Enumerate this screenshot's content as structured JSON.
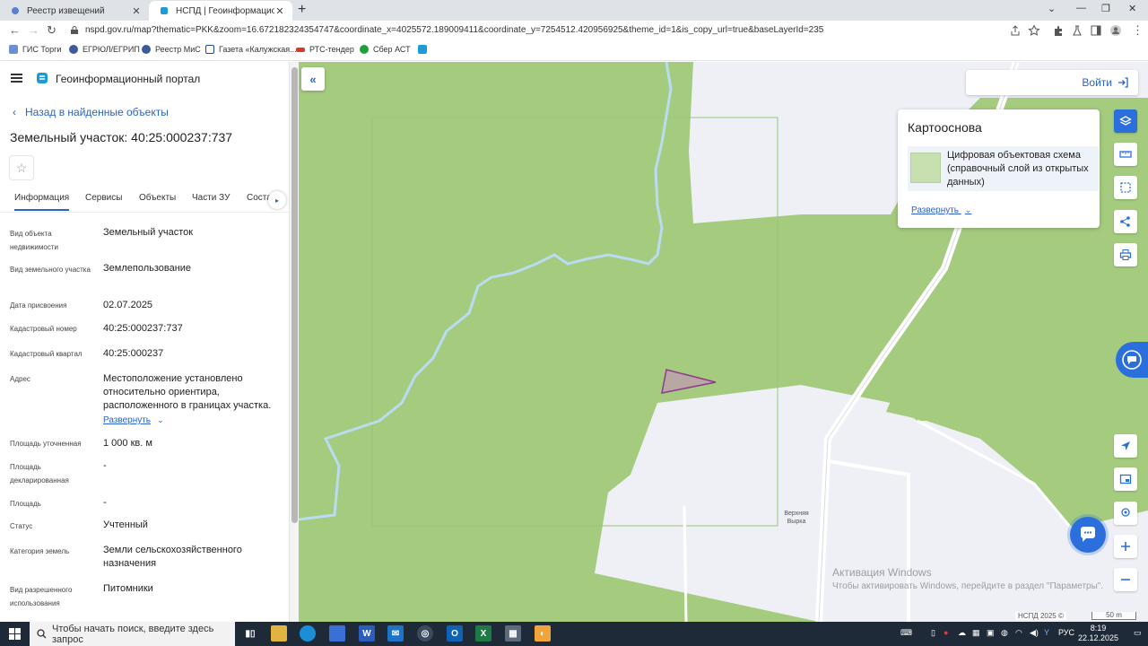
{
  "browser": {
    "tabs": [
      {
        "title": "Реестр извещений",
        "close": "✕",
        "icon": "gosuslugi-icon"
      },
      {
        "title": "НСПД | Геоинформационный п",
        "close": "✕",
        "icon": "nspd-icon"
      }
    ],
    "new_tab": "+",
    "url": "nspd.gov.ru/map?thematic=PKK&zoom=16.672182324354747&coordinate_x=4025572.189009411&coordinate_y=7254512.420956925&theme_id=1&is_copy_url=true&baseLayerId=235",
    "bookmarks": [
      {
        "label": "ГИС Торги",
        "icon": "gis-torgi-icon",
        "color": "#6b8ed6"
      },
      {
        "label": "ЕГРЮЛ/ЕГРИП",
        "icon": "egrul-icon",
        "color": "#3c5a9c"
      },
      {
        "label": "Реестр МиС",
        "icon": "reestr-mis-icon",
        "color": "#3c5a9c"
      },
      {
        "label": "Газета «Калужская...",
        "icon": "gazeta-icon",
        "color": "#1a4c9c"
      },
      {
        "label": "РТС-тендер",
        "icon": "rts-icon",
        "color": "#d83a2a"
      },
      {
        "label": "Сбер АСТ",
        "icon": "sber-icon",
        "color": "#21a038"
      },
      {
        "label": "",
        "icon": "nspd-bookmark-icon",
        "color": "#1e9bd7"
      }
    ]
  },
  "portal": {
    "title": "Геоинформационный портал",
    "back_link": "Назад в найденные объекты",
    "object_title": "Земельный участок: 40:25:000237:737",
    "tabs": [
      "Информация",
      "Сервисы",
      "Объекты",
      "Части ЗУ",
      "Соста"
    ],
    "tab_arrow": "▸",
    "properties": [
      {
        "label": "Вид объекта недвижимости",
        "value": "Земельный участок"
      },
      {
        "label": "Вид земельного участка",
        "value": "Землепользование"
      },
      {
        "label": "Дата присвоения",
        "value": "02.07.2025"
      },
      {
        "label": "Кадастровый номер",
        "value": "40:25:000237:737"
      },
      {
        "label": "Кадастровый квартал",
        "value": "40:25:000237"
      },
      {
        "label": "Адрес",
        "value": "Местоположение установлено относительно ориентира, расположенного в границах участка."
      },
      {
        "label": "Площадь уточненная",
        "value": "1 000 кв. м"
      },
      {
        "label": "Площадь декларированная",
        "value": "-"
      },
      {
        "label": "Площадь",
        "value": "-"
      },
      {
        "label": "Статус",
        "value": "Учтенный"
      },
      {
        "label": "Категория земель",
        "value": "Земли сельскохозяйственного назначения"
      },
      {
        "label": "Вид разрешенного использования",
        "value": "Питомники"
      }
    ],
    "address_expand": "Развернуть"
  },
  "map": {
    "login": "Войти",
    "basemap_title": "Картооснова",
    "basemap_layer": "Цифровая объектовая схема (справочный слой из открытых данных)",
    "basemap_expand": "Развернуть",
    "place_label": "Верхняя Вырка",
    "watermark_title": "Активация Windows",
    "watermark_sub": "Чтобы активировать Windows, перейдите в раздел \"Параметры\".",
    "copyright": "НСПД 2025 ©",
    "scale": "50 m",
    "colors": {
      "forest": "#a5cb7f",
      "open_land": "#eef0f6",
      "river": "#b9dcf2",
      "parcel_fill": "#b9a7a3",
      "parcel_stroke": "#8e3b8e",
      "accent": "#2b6fdc"
    }
  },
  "taskbar": {
    "search_placeholder": "Чтобы начать поиск, введите здесь запрос",
    "lang": "РУС",
    "time": "8:19",
    "date": "22.12.2025"
  }
}
